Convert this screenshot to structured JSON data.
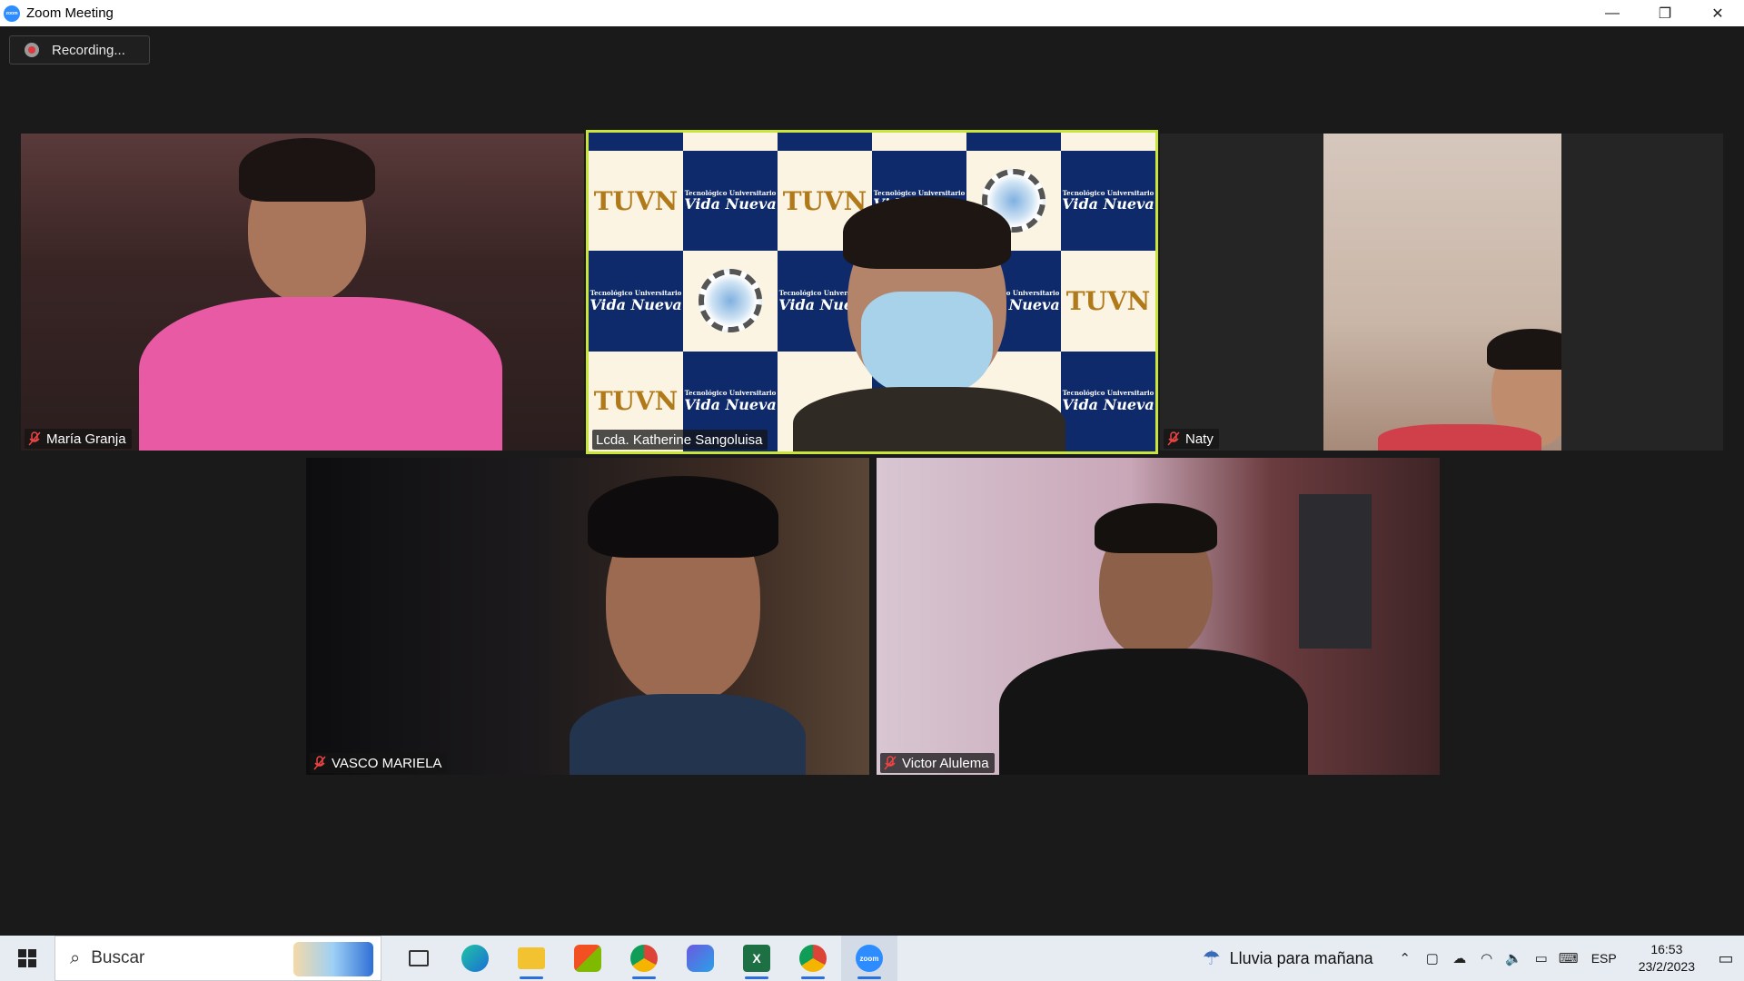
{
  "window": {
    "title": "Zoom Meeting",
    "app_icon_text": "zoom",
    "controls": [
      "—",
      "❐",
      "✕"
    ]
  },
  "recording": {
    "label": "Recording..."
  },
  "participants": [
    {
      "name": "María Granja",
      "muted": true
    },
    {
      "name": "Lcda. Katherine Sangoluisa",
      "muted": false,
      "active_speaker": true
    },
    {
      "name": "Naty",
      "muted": true
    },
    {
      "name": "VASCO MARIELA",
      "muted": true
    },
    {
      "name": "Victor Alulema",
      "muted": true
    }
  ],
  "banner": {
    "logo_text": "TUVN",
    "small_text": "Tecnológico Universitario",
    "brand_text": "Vida Nueva"
  },
  "taskbar": {
    "search_placeholder": "Buscar",
    "apps": [
      "task-view",
      "edge",
      "file-explorer",
      "microsoft-store",
      "chrome",
      "copilot",
      "excel",
      "chrome-profile",
      "zoom"
    ],
    "weather": "Lluvia para mañana",
    "language": "ESP",
    "time": "16:53",
    "date": "23/2/2023"
  },
  "colors": {
    "active_speaker_border": "#c9e53a",
    "meeting_bg": "#1a1a1a",
    "recording_dot": "#e0383e",
    "taskbar_bg": "#e7ecf3"
  }
}
